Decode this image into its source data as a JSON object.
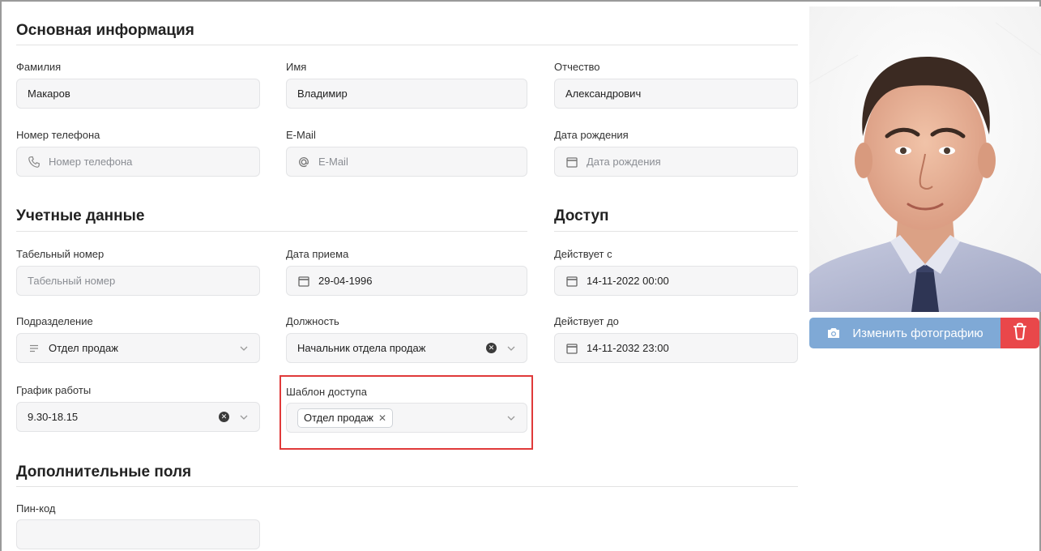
{
  "sections": {
    "main_info": "Основная информация",
    "credentials": "Учетные данные",
    "access": "Доступ",
    "extra": "Дополнительные поля"
  },
  "fields": {
    "last_name": {
      "label": "Фамилия",
      "value": "Макаров"
    },
    "first_name": {
      "label": "Имя",
      "value": "Владимир"
    },
    "patronymic": {
      "label": "Отчество",
      "value": "Александрович"
    },
    "phone": {
      "label": "Номер телефона",
      "placeholder": "Номер телефона",
      "icon": "phone-icon"
    },
    "email": {
      "label": "E-Mail",
      "placeholder": "E-Mail",
      "icon": "at-icon"
    },
    "birth_date": {
      "label": "Дата рождения",
      "placeholder": "Дата рождения",
      "icon": "calendar-icon"
    },
    "tab_number": {
      "label": "Табельный номер",
      "placeholder": "Табельный номер"
    },
    "hire_date": {
      "label": "Дата приема",
      "value": "29-04-1996",
      "icon": "calendar-icon"
    },
    "valid_from": {
      "label": "Действует с",
      "value": "14-11-2022 00:00",
      "icon": "calendar-icon"
    },
    "department": {
      "label": "Подразделение",
      "value": "Отдел продаж",
      "icon": "list-icon"
    },
    "position": {
      "label": "Должность",
      "value": "Начальник отдела продаж"
    },
    "valid_to": {
      "label": "Действует до",
      "value": "14-11-2032 23:00",
      "icon": "calendar-icon"
    },
    "schedule": {
      "label": "График работы",
      "value": "9.30-18.15"
    },
    "access_template": {
      "label": "Шаблон доступа",
      "tags": [
        "Отдел продаж"
      ]
    },
    "pin": {
      "label": "Пин-код",
      "value": ""
    }
  },
  "photo": {
    "change_label": "Изменить фотографию"
  },
  "colors": {
    "photo_button": "#7fa9d6",
    "delete_button": "#e9474a",
    "highlight": "#e03a3a"
  }
}
